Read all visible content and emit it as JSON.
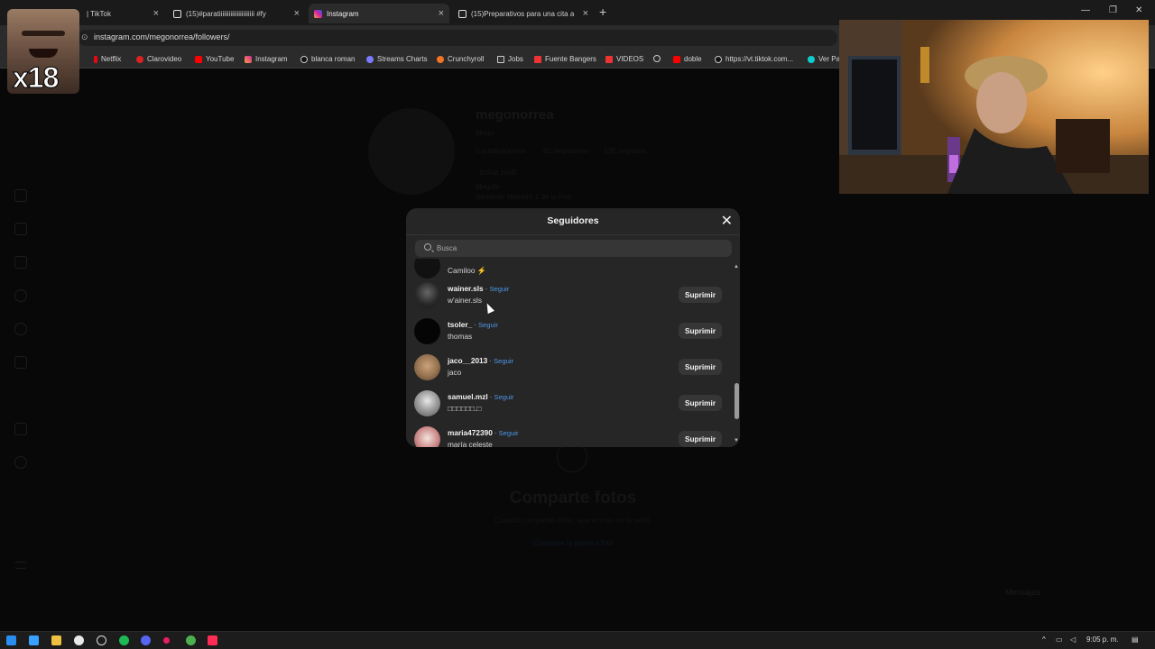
{
  "browser": {
    "tabs": [
      {
        "label": "| TikTok",
        "active": false
      },
      {
        "label": "(15)#paratiiiiiiiiiiiiiiiiiiiiii #fy",
        "active": false
      },
      {
        "label": "Instagram",
        "active": true
      },
      {
        "label": "(15)Preparativos para una cita a",
        "active": false
      }
    ],
    "url": "instagram.com/megonorrea/followers/",
    "bookmarks": [
      "Netflix",
      "Clarovideo",
      "YouTube",
      "Instagram",
      "blanca roman",
      "Streams Charts",
      "Crunchyroll",
      "Jobs",
      "Fuente Bangers",
      "VIDEOS",
      "doble",
      "https://vt.tiktok.com...",
      "Ver Pa"
    ]
  },
  "profile": {
    "username": "megonorrea",
    "display_name": "Mego",
    "posts": "0 publicaciones",
    "followers": "81 seguidores",
    "following": "135 seguidos",
    "edit_button": "Editar perfil",
    "bio_name": "Megote",
    "bio_line": "Streamer Numero 1 de la Fna",
    "empty_title": "Comparte fotos",
    "empty_sub": "Cuando compartas fotos, aparecerán en tu perfil.",
    "empty_link": "Comparte tu primera foto",
    "messages_label": "Mensajes"
  },
  "modal": {
    "title": "Seguidores",
    "search_placeholder": "Busca",
    "follow_label": "Seguir",
    "remove_label": "Suprimir",
    "partial_top": "Camiloo ⚡",
    "followers": [
      {
        "username": "wainer.sls",
        "name": "w'ainer.sls"
      },
      {
        "username": "tsoler_",
        "name": "thomas"
      },
      {
        "username": "jaco__2013",
        "name": "jaco"
      },
      {
        "username": "samuel.mzl",
        "name": "□□□□□□.□"
      },
      {
        "username": "maria472390",
        "name": "maría celeste"
      }
    ]
  },
  "overlay": {
    "badge": "x18"
  },
  "taskbar": {
    "clock": "9:05 p. m."
  },
  "colors": {
    "accent": "#4f97e8",
    "modal_bg": "#262626"
  }
}
